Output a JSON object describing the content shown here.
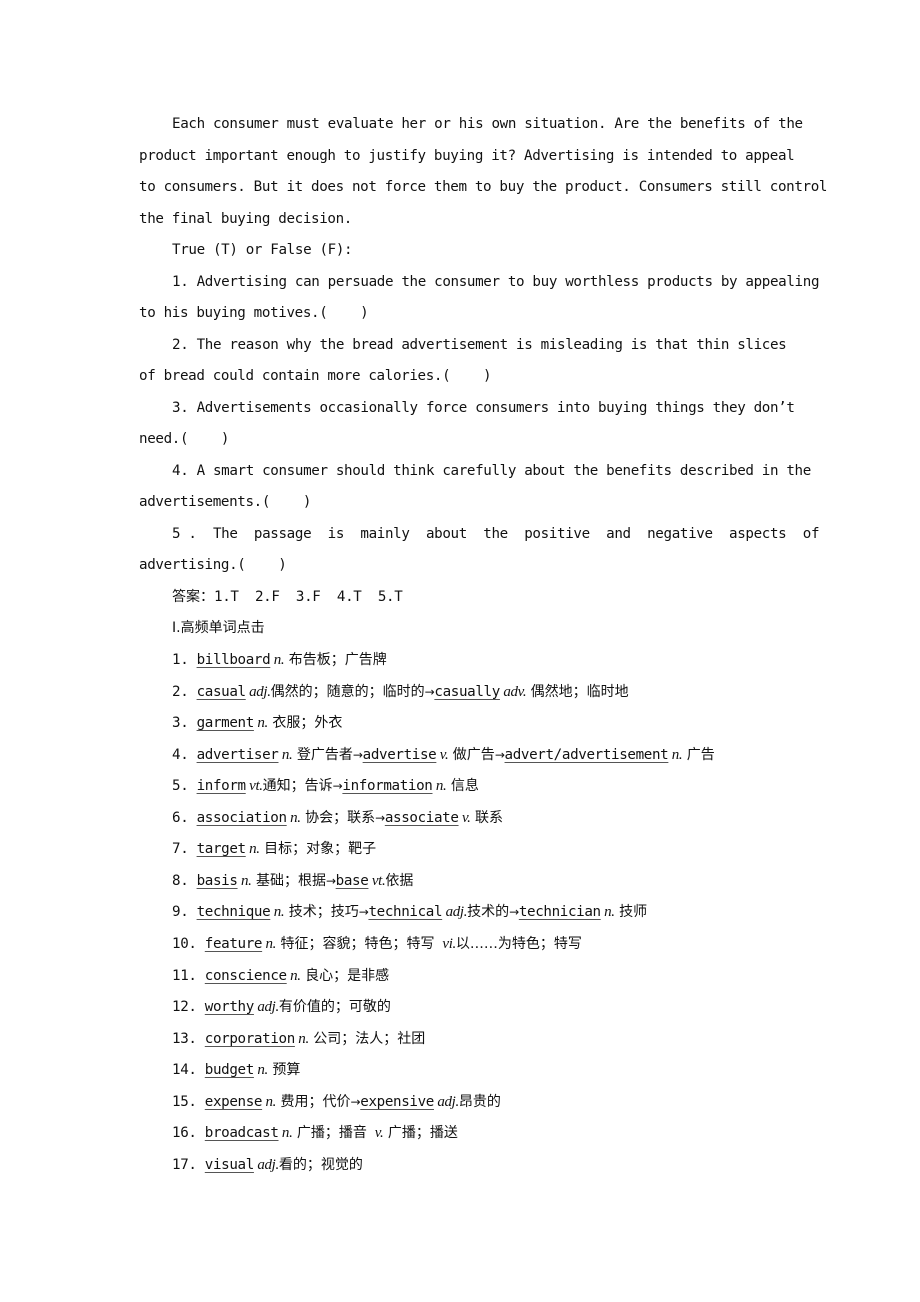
{
  "passage": {
    "lines": [
      "Each consumer must evaluate her or his own situation. Are the benefits of the",
      "product important enough to justify buying it? Advertising is intended to appeal",
      "to consumers. But it does not force them to buy the product. Consumers still control",
      "the final buying decision."
    ]
  },
  "exercise": {
    "heading": "True (T) or False (F):",
    "questions": [
      {
        "line1": "1. Advertising can persuade the consumer to buy worthless products by appealing",
        "line2": "to his buying motives.(    )"
      },
      {
        "line1": "2. The reason why the bread advertisement is misleading is that thin slices",
        "line2": "of bread could contain more calories.(    )"
      },
      {
        "line1": "3. Advertisements occasionally force consumers into buying things they don’t",
        "line2": "need.(    )"
      },
      {
        "line1": "4. A smart consumer should think carefully about the benefits described in the",
        "line2": "advertisements.(    )"
      },
      {
        "line1": "5 .  The  passage  is  mainly  about  the  positive  and  negative  aspects  of",
        "line2": "advertising.(    )"
      }
    ],
    "answer_label": "答案：",
    "answers": "1.T  2.F  3.F  4.T  5.T"
  },
  "section": {
    "title": "Ⅰ.高频单词点击"
  },
  "vocab": [
    {
      "num": "1.",
      "segs": [
        [
          "w",
          "billboard"
        ],
        [
          "p",
          " n."
        ],
        [
          "z",
          " 布告板；广告牌"
        ]
      ]
    },
    {
      "num": "2.",
      "segs": [
        [
          "w",
          "casual"
        ],
        [
          "p",
          " adj."
        ],
        [
          "z",
          "偶然的；随意的；临时的"
        ],
        [
          "a",
          "→"
        ],
        [
          "w",
          "casually"
        ],
        [
          "p",
          " adv."
        ],
        [
          "z",
          " 偶然地；临时地"
        ]
      ]
    },
    {
      "num": "3.",
      "segs": [
        [
          "w",
          "garment"
        ],
        [
          "p",
          " n."
        ],
        [
          "z",
          " 衣服；外衣"
        ]
      ]
    },
    {
      "num": "4.",
      "segs": [
        [
          "w",
          "advertiser"
        ],
        [
          "p",
          " n."
        ],
        [
          "z",
          " 登广告者"
        ],
        [
          "a",
          "→"
        ],
        [
          "w",
          "advertise"
        ],
        [
          "p",
          " v."
        ],
        [
          "z",
          " 做广告"
        ],
        [
          "a",
          "→"
        ],
        [
          "w",
          "advert/advertisement"
        ],
        [
          "p",
          " n."
        ],
        [
          "z",
          " 广告"
        ]
      ]
    },
    {
      "num": "5.",
      "segs": [
        [
          "w",
          "inform"
        ],
        [
          "p",
          " vt."
        ],
        [
          "z",
          "通知；告诉"
        ],
        [
          "a",
          "→"
        ],
        [
          "w",
          "information"
        ],
        [
          "p",
          " n."
        ],
        [
          "z",
          " 信息"
        ]
      ]
    },
    {
      "num": "6.",
      "segs": [
        [
          "w",
          "association"
        ],
        [
          "p",
          " n."
        ],
        [
          "z",
          " 协会；联系"
        ],
        [
          "a",
          "→"
        ],
        [
          "w",
          "associate"
        ],
        [
          "p",
          " v."
        ],
        [
          "z",
          " 联系"
        ]
      ]
    },
    {
      "num": "7.",
      "segs": [
        [
          "w",
          "target"
        ],
        [
          "p",
          " n."
        ],
        [
          "z",
          " 目标；对象；靶子"
        ]
      ]
    },
    {
      "num": "8.",
      "segs": [
        [
          "w",
          "basis"
        ],
        [
          "p",
          " n."
        ],
        [
          "z",
          " 基础；根据"
        ],
        [
          "a",
          "→"
        ],
        [
          "w",
          "base"
        ],
        [
          "p",
          " vt."
        ],
        [
          "z",
          "依据"
        ]
      ]
    },
    {
      "num": "9.",
      "segs": [
        [
          "w",
          "technique"
        ],
        [
          "p",
          " n."
        ],
        [
          "z",
          " 技术；技巧"
        ],
        [
          "a",
          "→"
        ],
        [
          "w",
          "technical"
        ],
        [
          "p",
          " adj."
        ],
        [
          "z",
          "技术的"
        ],
        [
          "a",
          "→"
        ],
        [
          "w",
          "technician"
        ],
        [
          "p",
          " n."
        ],
        [
          "z",
          " 技师"
        ]
      ]
    },
    {
      "num": "10.",
      "segs": [
        [
          "w",
          "feature"
        ],
        [
          "p",
          " n."
        ],
        [
          "z",
          " 特征；容貌；特色；特写 "
        ],
        [
          "p",
          " vi."
        ],
        [
          "z",
          "以……为特色；特写"
        ]
      ]
    },
    {
      "num": "11.",
      "segs": [
        [
          "w",
          "conscience"
        ],
        [
          "p",
          " n."
        ],
        [
          "z",
          " 良心；是非感"
        ]
      ]
    },
    {
      "num": "12.",
      "segs": [
        [
          "w",
          "worthy"
        ],
        [
          "p",
          " adj."
        ],
        [
          "z",
          "有价值的；可敬的"
        ]
      ]
    },
    {
      "num": "13.",
      "segs": [
        [
          "w",
          "corporation"
        ],
        [
          "p",
          " n."
        ],
        [
          "z",
          " 公司；法人；社团"
        ]
      ]
    },
    {
      "num": "14.",
      "segs": [
        [
          "w",
          "budget"
        ],
        [
          "p",
          " n."
        ],
        [
          "z",
          " 预算"
        ]
      ]
    },
    {
      "num": "15.",
      "segs": [
        [
          "w",
          "expense"
        ],
        [
          "p",
          " n."
        ],
        [
          "z",
          " 费用；代价"
        ],
        [
          "a",
          "→"
        ],
        [
          "w",
          "expensive"
        ],
        [
          "p",
          " adj."
        ],
        [
          "z",
          "昂贵的"
        ]
      ]
    },
    {
      "num": "16.",
      "segs": [
        [
          "w",
          "broadcast"
        ],
        [
          "p",
          " n."
        ],
        [
          "z",
          " 广播；播音 "
        ],
        [
          "p",
          " v."
        ],
        [
          "z",
          " 广播；播送"
        ]
      ]
    },
    {
      "num": "17.",
      "segs": [
        [
          "w",
          "visual"
        ],
        [
          "p",
          " adj."
        ],
        [
          "z",
          "看的；视觉的"
        ]
      ]
    }
  ]
}
